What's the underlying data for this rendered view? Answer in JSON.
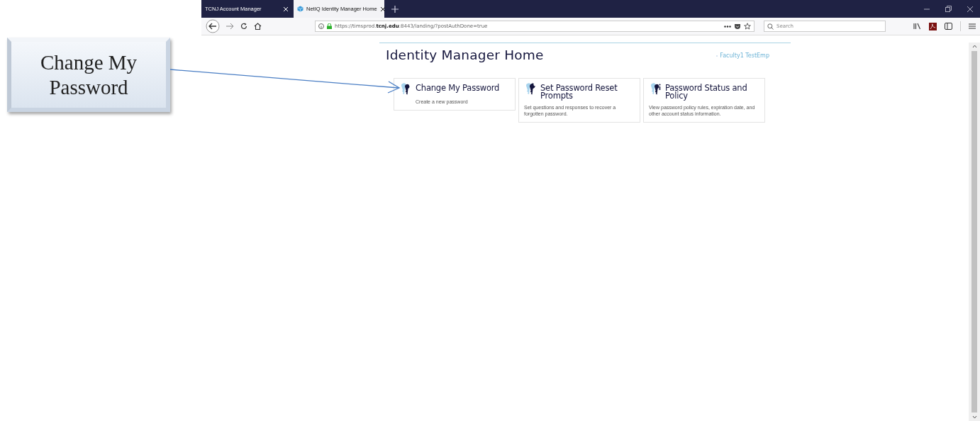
{
  "annotation": {
    "callout": "Change My Password"
  },
  "browser": {
    "tabs": [
      {
        "title": "TCNJ Account Manager",
        "selected": false
      },
      {
        "title": "NetIQ Identity Manager Home",
        "selected": true
      }
    ],
    "url": "https://timsprod.**tcnj.edu**:8443/landing/?postAuthDone=true",
    "search": {
      "placeholder": "Search"
    }
  },
  "page": {
    "title": "Identity Manager Home",
    "user": "Faculty1 TestEmp",
    "cards": [
      {
        "kind": "change",
        "title": "Change My Password",
        "description": "Create a new password"
      },
      {
        "kind": "reset",
        "title": "Set Password Reset Prompts",
        "description": "Set questions and responses to recover a forgotten password."
      },
      {
        "kind": "status",
        "title": "Password Status and Policy",
        "description": "View password policy rules, expiration date, and other account status information."
      }
    ]
  }
}
